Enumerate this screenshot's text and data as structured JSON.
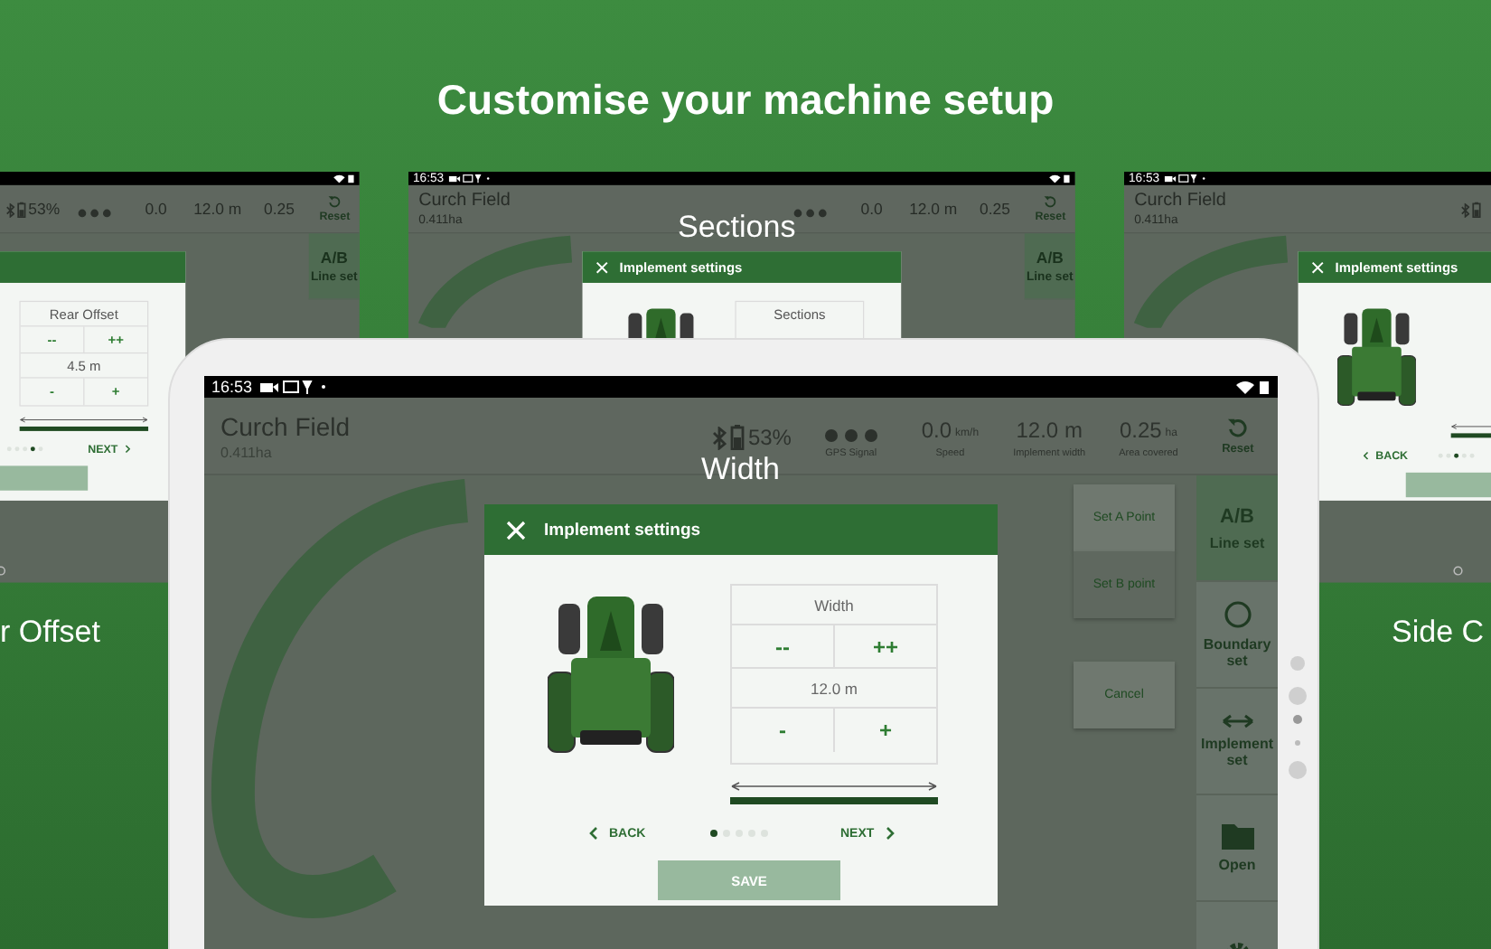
{
  "headline": "Customise your machine setup",
  "background_screens": [
    {
      "stats": [
        {
          "kind": "battery",
          "value": "53%"
        },
        {
          "kind": "gps"
        },
        {
          "kind": "reading",
          "value": "0.0"
        },
        {
          "kind": "reading",
          "value": "12.0 m"
        },
        {
          "kind": "reading",
          "value": "0.25"
        }
      ],
      "reset_label": "Reset",
      "wifi_battery": true,
      "side_nav": [
        {
          "kind": "ab",
          "icon_text": "A/B",
          "label": "Line set",
          "selected": true
        }
      ],
      "dialog": {
        "rows": [
          {
            "kind": "label",
            "text": "Rear Offset"
          },
          {
            "kind": "buttons",
            "items": [
              "--",
              "++"
            ]
          },
          {
            "kind": "value",
            "text": "4.5 m"
          },
          {
            "kind": "buttons",
            "items": [
              "-",
              "+"
            ]
          }
        ],
        "width_indicator": true,
        "pages": [
          {
            "selected": false
          },
          {
            "selected": false
          },
          {
            "selected": false
          },
          {
            "selected": true
          },
          {
            "selected": false
          }
        ],
        "next": "NEXT",
        "save": {
          "disabled": true
        }
      },
      "nav_bar": true
    },
    {
      "status_time": "16:53",
      "header": {
        "title": "Curch Field",
        "subtitle": "0.411ha"
      },
      "stats": [
        {
          "kind": "none"
        },
        {
          "kind": "gps"
        },
        {
          "kind": "reading",
          "value": "0.0"
        },
        {
          "kind": "reading",
          "value": "12.0 m"
        },
        {
          "kind": "reading",
          "value": "0.25"
        }
      ],
      "reset_label": "Reset",
      "wifi_battery": true,
      "side_nav": [
        {
          "kind": "ab",
          "icon_text": "A/B",
          "label": "Line set",
          "selected": true
        }
      ],
      "dialog": {
        "title": "Implement settings",
        "vehicle": true,
        "rows": [
          {
            "kind": "label",
            "text": "Sections"
          }
        ]
      }
    },
    {
      "status_time": "16:53",
      "header": {
        "title": "Curch Field",
        "subtitle": "0.411ha"
      },
      "stats": [
        {
          "kind": "battery"
        }
      ],
      "dialog": {
        "title": "Implement settings",
        "vehicle": true,
        "width_indicator": true,
        "back": "BACK",
        "pages": [
          {
            "selected": false
          },
          {
            "selected": false
          },
          {
            "selected": true
          },
          {
            "selected": false
          },
          {
            "selected": false
          }
        ],
        "save": {
          "disabled": true
        }
      },
      "nav_bar": true
    }
  ],
  "tablet": {
    "screen": {
      "status_time": "16:53",
      "header": {
        "title": "Curch Field",
        "subtitle": "0.411ha"
      },
      "stats": [
        {
          "kind": "battery",
          "value": "53%"
        },
        {
          "kind": "gps",
          "label": "GPS Signal"
        },
        {
          "kind": "reading",
          "value": "0.0",
          "unit": "km/h",
          "label": "Speed"
        },
        {
          "kind": "reading",
          "value": "12.0 m",
          "label": "Implement width"
        },
        {
          "kind": "reading",
          "value": "0.25",
          "unit": "ha",
          "label": "Area covered"
        }
      ],
      "reset_label": "Reset",
      "wifi_battery": true,
      "floating_buttons": [
        {
          "label": "Set A Point",
          "disabled": false
        },
        {
          "label": "Set B point",
          "disabled": true
        },
        {
          "label": "Cancel",
          "disabled": false
        }
      ],
      "side_nav": [
        {
          "kind": "ab",
          "icon_text": "A/B",
          "label": "Line set",
          "selected": true
        },
        {
          "kind": "boundary",
          "label": "Boundary set",
          "selected": false
        },
        {
          "kind": "implement",
          "label": "Implement set",
          "selected": false
        },
        {
          "kind": "open",
          "label": "Open",
          "selected": false
        },
        {
          "kind": "settings",
          "selected": false
        }
      ],
      "dialog": {
        "title": "Implement settings",
        "vehicle": true,
        "rows": [
          {
            "kind": "label",
            "text": "Width"
          },
          {
            "kind": "buttons",
            "items": [
              "--",
              "++"
            ]
          },
          {
            "kind": "value",
            "text": "12.0 m"
          },
          {
            "kind": "buttons",
            "items": [
              "-",
              "+"
            ]
          }
        ],
        "width_indicator": true,
        "back": "BACK",
        "pages": [
          {
            "selected": true
          },
          {
            "selected": false
          },
          {
            "selected": false
          },
          {
            "selected": false
          },
          {
            "selected": false
          }
        ],
        "next": "NEXT",
        "save": {
          "label": "SAVE",
          "disabled": true
        }
      }
    }
  },
  "captions": [
    "r Offset",
    "Sections",
    "Width",
    "Side C"
  ]
}
